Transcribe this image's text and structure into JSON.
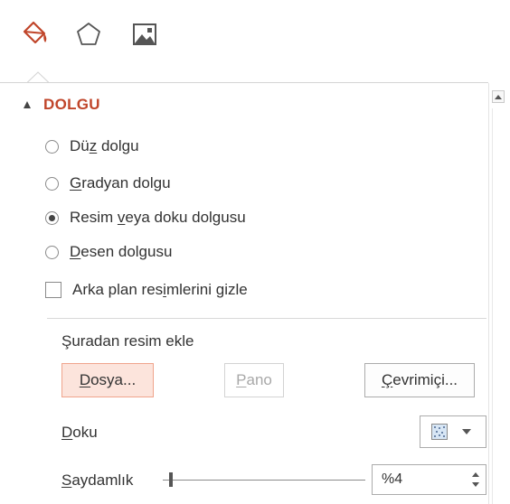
{
  "tabs": [
    {
      "name": "fill-line-tab",
      "icon": "paint-bucket-icon"
    },
    {
      "name": "effects-tab",
      "icon": "pentagon-icon"
    },
    {
      "name": "picture-tab",
      "icon": "picture-icon"
    }
  ],
  "section": {
    "title": "DOLGU"
  },
  "fill_options": [
    {
      "before": "Dü",
      "key": "z",
      "after": " dolgu",
      "checked": false
    },
    {
      "before": "",
      "key": "G",
      "after": "radyan dolgu",
      "checked": false
    },
    {
      "before": "Resim ",
      "key": "v",
      "after": "eya doku dolgusu",
      "checked": true
    },
    {
      "before": "",
      "key": "D",
      "after": "esen dolgusu",
      "checked": false
    }
  ],
  "hide_background": {
    "before": "Arka plan res",
    "key": "i",
    "after": "mlerini gizle",
    "checked": false
  },
  "insert_from": {
    "label": "Şuradan resim ekle"
  },
  "buttons": {
    "file": {
      "key": "D",
      "rest": "osya..."
    },
    "clipboard": {
      "key": "P",
      "rest": "ano"
    },
    "online": {
      "key": "Ç",
      "rest": "evrimiçi..."
    }
  },
  "texture": {
    "key": "D",
    "rest": "oku"
  },
  "transparency": {
    "key": "S",
    "rest": "aydamlık",
    "value": "%4",
    "level_percent": 4
  },
  "colors": {
    "accent": "#c0452a",
    "primary_button_bg": "#fce4dc",
    "primary_button_border": "#f0a48c"
  }
}
